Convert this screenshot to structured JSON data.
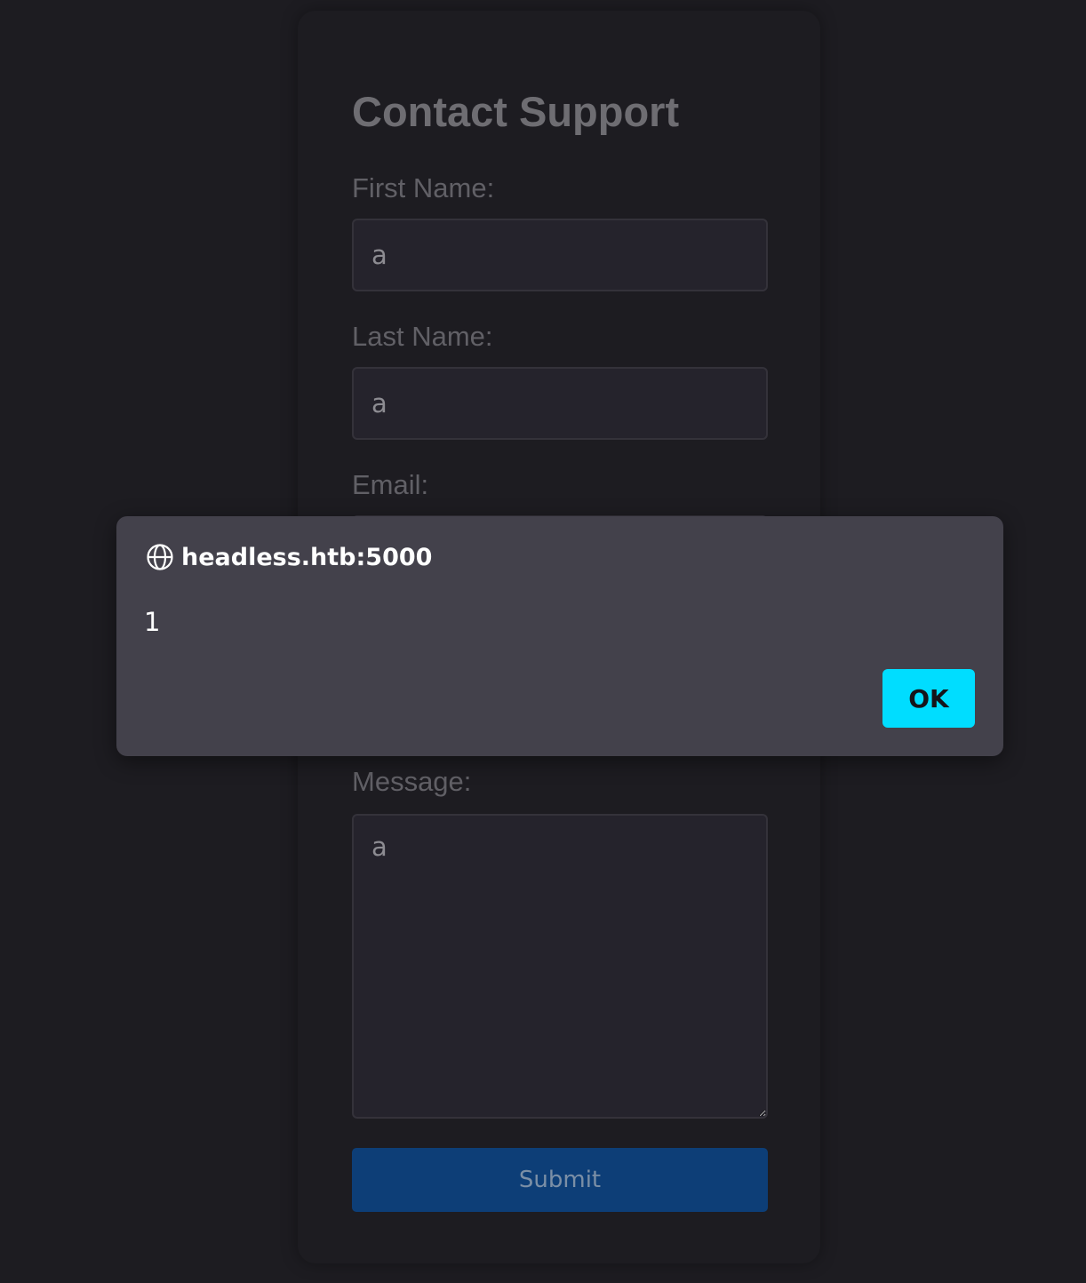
{
  "form": {
    "title": "Contact Support",
    "first_name_label": "First Name:",
    "first_name_value": "a",
    "last_name_label": "Last Name:",
    "last_name_value": "a",
    "email_label": "Email:",
    "message_label": "Message:",
    "message_value": "a",
    "submit_label": "Submit"
  },
  "alert": {
    "origin": "headless.htb:5000",
    "message": "1",
    "ok_label": "OK",
    "icon": "globe-icon"
  },
  "colors": {
    "background": "#1d1c21",
    "dialog": "#43414b",
    "ok_button": "#00ddff",
    "submit_button": "#0d3e77"
  }
}
